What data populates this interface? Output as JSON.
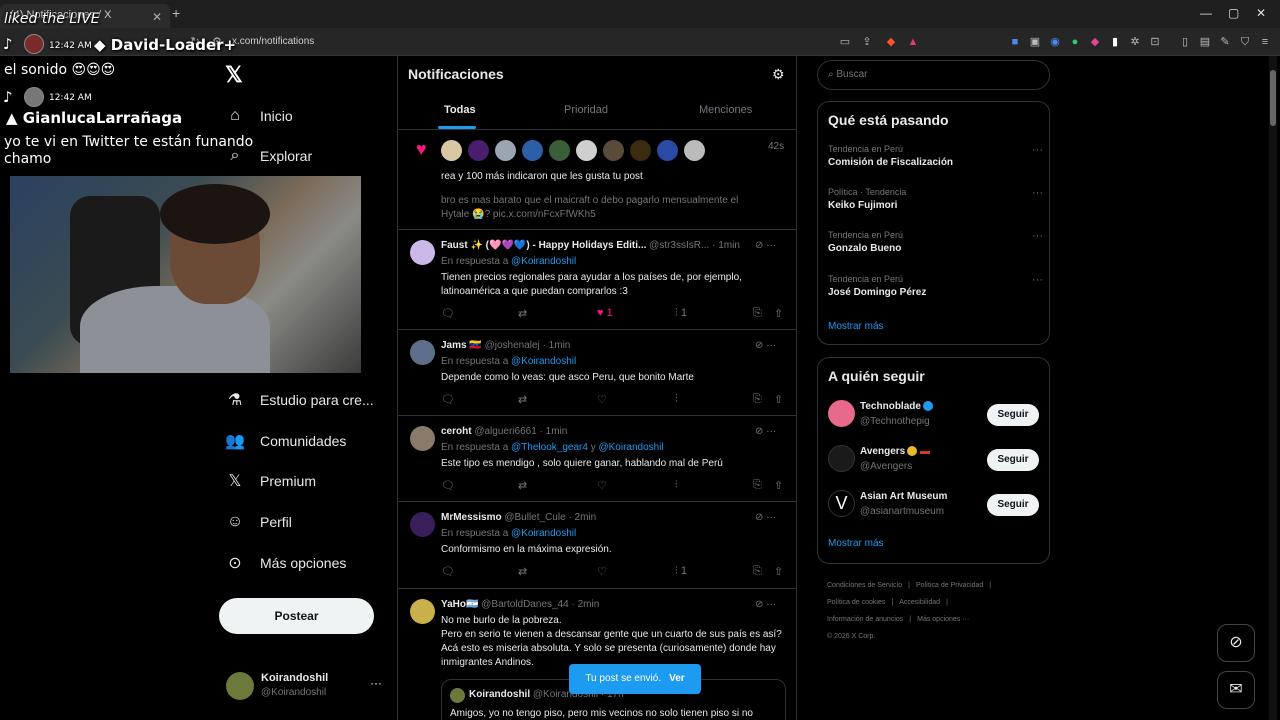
{
  "browser": {
    "tab_title": "(4) Notificaciones / X",
    "new_tab": "+",
    "url": "x.com/notifications",
    "win_min": "—",
    "win_max": "▢",
    "win_close": "✕"
  },
  "overlay": {
    "title": "liked the LIVE",
    "line1_time": "12:42 AM",
    "line1_name": "David-Loader+",
    "line1_msg": "el sonido 😍😍😍",
    "line2_time": "12:42 AM",
    "line2_name": "GianlucaLarrañaga",
    "line2_msg": "yo te vi en Twitter te están funando chamo"
  },
  "nav": {
    "items": [
      {
        "label": "Inicio",
        "icon": "home-icon"
      },
      {
        "label": "Explorar",
        "icon": "search-icon"
      },
      {
        "label": "Estudio para cre...",
        "icon": "flask-icon"
      },
      {
        "label": "Comunidades",
        "icon": "communities-icon"
      },
      {
        "label": "Premium",
        "icon": "x-icon"
      },
      {
        "label": "Perfil",
        "icon": "person-icon"
      },
      {
        "label": "Más opciones",
        "icon": "more-circle-icon"
      }
    ],
    "post_button": "Postear",
    "account_name": "Koirandoshil",
    "account_handle": "@Koirandoshil"
  },
  "main": {
    "title": "Notificaciones",
    "tabs": [
      "Todas",
      "Prioridad",
      "Menciones"
    ],
    "like_notif": {
      "time": "42s",
      "text": "rea y 100 más indicaron que les gusta tu post",
      "snippet": "bro es mas barato que el maicraft o debo pagarlo mensualmente el Hytale 😭? pic.x.com/nFcxFfWKh5"
    },
    "posts": [
      {
        "name": "Faust ✨ (🩷💜💙) - Happy Holidays Editi...",
        "handle": "@str3ssIsR...",
        "time": "· 1min",
        "reply_prefix": "En respuesta a ",
        "reply_to": "@Koirandoshil",
        "reply_mid": "",
        "reply_to2": "",
        "text": "Tienen precios regionales para ayudar a los países de, por ejemplo, latinoamérica a que puedan comprarlos :3",
        "likes": "1",
        "views": "1"
      },
      {
        "name": "Jams 🇻🇪",
        "handle": "@joshenalej",
        "time": "· 1min",
        "reply_prefix": "En respuesta a ",
        "reply_to": "@Koirandoshil",
        "reply_mid": "",
        "reply_to2": "",
        "text": "Depende como lo veas: que asco Peru, que bonito Marte",
        "likes": "",
        "views": ""
      },
      {
        "name": "ceroht",
        "handle": "@algueri6661",
        "time": "· 1min",
        "reply_prefix": "En respuesta a ",
        "reply_to": "@Thelook_gear4",
        "reply_mid": " y ",
        "reply_to2": "@Koirandoshil",
        "text": "Este tipo es mendigo , solo quiere ganar, hablando mal de Perú",
        "likes": "",
        "views": ""
      },
      {
        "name": "MrMessismo",
        "handle": "@Bullet_Cule",
        "time": "· 2min",
        "reply_prefix": "En respuesta a ",
        "reply_to": "@Koirandoshil",
        "reply_mid": "",
        "reply_to2": "",
        "text": "Conformismo en la máxima expresión.",
        "likes": "",
        "views": "1"
      },
      {
        "name": "YaHo🇦🇷",
        "handle": "@BartoldDanes_44",
        "time": "· 2min",
        "text": "No me burlo de la pobreza.\nPero en serio te vienen a descansar gente que un cuarto de sus país es así? Acá esto es miseria absoluta. Y solo se presenta (curiosamente) donde hay inmigrantes Andinos.",
        "quote_name": "Koirandoshil",
        "quote_handle": "@Koirandoshil · 17h",
        "quote_text": "Amigos, yo no tengo piso, pero mis vecinos no solo tienen piso si no"
      }
    ],
    "toast": {
      "text": "Tu post se envió.",
      "action": "Ver"
    }
  },
  "right": {
    "search_placeholder": "Buscar",
    "trends_title": "Qué está pasando",
    "trends": [
      {
        "meta": "Tendencia en Perú",
        "name": "Comisión de Fiscalización"
      },
      {
        "meta": "Política · Tendencia",
        "name": "Keiko Fujimori"
      },
      {
        "meta": "Tendencia en Perú",
        "name": "Gonzalo Bueno"
      },
      {
        "meta": "Tendencia en Perú",
        "name": "José Domingo Pérez"
      }
    ],
    "show_more": "Mostrar más",
    "follow_title": "A quién seguir",
    "follow": [
      {
        "name": "Technoblade",
        "handle": "@Technothepig",
        "color": "#e86a8a"
      },
      {
        "name": "Avengers",
        "handle": "@Avengers",
        "color": "#1a1a1a"
      },
      {
        "name": "Asian Art Museum",
        "handle": "@asianartmuseum",
        "color": "#000000"
      }
    ],
    "follow_button": "Seguir",
    "follow_show_more": "Mostrar más",
    "footer": [
      "Condiciones de Servicio",
      "|",
      "Política de Privacidad",
      "|",
      "Política de cookies",
      "|",
      "Accesibilidad",
      "|",
      "Información de anuncios",
      "|",
      "Más opciones ···",
      "© 2026 X Corp."
    ]
  },
  "colors": {
    "accent": "#1d9bf0",
    "like": "#f91880",
    "bg": "#000000"
  }
}
